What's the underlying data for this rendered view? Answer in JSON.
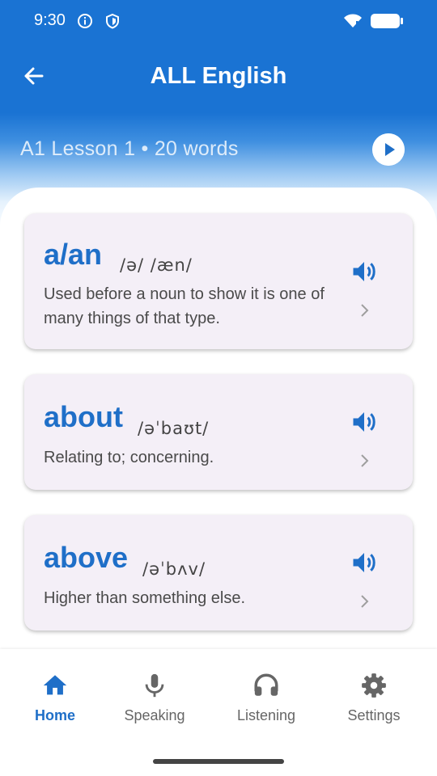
{
  "status_bar": {
    "time": "9:30",
    "icons": [
      "info-icon",
      "shield-icon",
      "wifi-icon",
      "battery-icon"
    ]
  },
  "app_bar": {
    "title": "ALL English",
    "back_icon": "arrow-back-icon"
  },
  "lesson": {
    "label": "A1 Lesson 1 • 20 words",
    "play_icon": "play-icon"
  },
  "words": [
    {
      "word": "a/an",
      "phonetic": "/ə/  /æn/",
      "definition": "Used before a noun to show it is one of many things of that type."
    },
    {
      "word": "about",
      "phonetic": "/əˈbaʊt/",
      "definition": "Relating to; concerning."
    },
    {
      "word": "above",
      "phonetic": "/əˈbʌv/",
      "definition": "Higher than something else."
    }
  ],
  "nav": [
    {
      "label": "Home",
      "icon": "home-icon",
      "active": true
    },
    {
      "label": "Speaking",
      "icon": "microphone-icon",
      "active": false
    },
    {
      "label": "Listening",
      "icon": "headphones-icon",
      "active": false
    },
    {
      "label": "Settings",
      "icon": "gear-icon",
      "active": false
    }
  ],
  "colors": {
    "primary": "#1a73d3",
    "word_color": "#1f6fc8",
    "card_bg": "#f4eff7",
    "inactive_nav": "#666666"
  }
}
